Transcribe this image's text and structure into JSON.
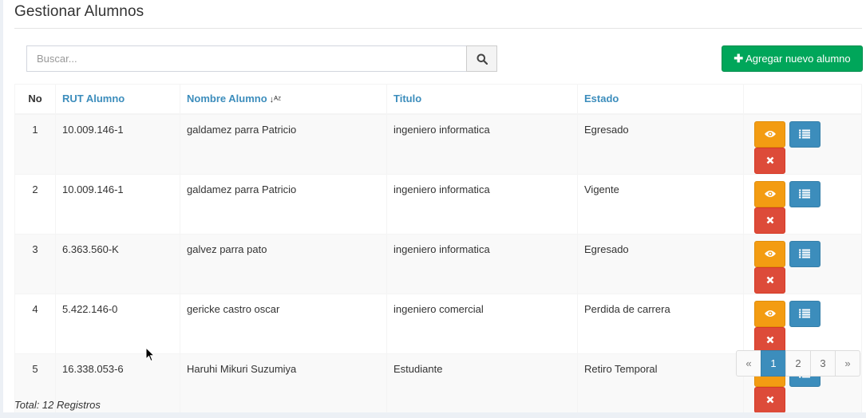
{
  "page": {
    "title": "Gestionar Alumnos",
    "total_label": "Total: 12 Registros"
  },
  "search": {
    "placeholder": "Buscar...",
    "button_icon": "search-icon"
  },
  "add_button": {
    "icon": "plus-icon",
    "label": "Agregar nuevo alumno"
  },
  "table": {
    "headers": {
      "no": "No",
      "rut": "RUT Alumno",
      "nombre": "Nombre Alumno",
      "titulo": "Titulo",
      "estado": "Estado"
    },
    "sort_icon": "sort-alpha-asc-icon",
    "rows": [
      {
        "no": "1",
        "rut": "10.009.146-1",
        "nombre": "galdamez parra Patricio",
        "titulo": "ingeniero informatica",
        "estado": "Egresado"
      },
      {
        "no": "2",
        "rut": "10.009.146-1",
        "nombre": "galdamez parra Patricio",
        "titulo": "ingeniero informatica",
        "estado": "Vigente"
      },
      {
        "no": "3",
        "rut": "6.363.560-K",
        "nombre": "galvez parra pato",
        "titulo": "ingeniero informatica",
        "estado": "Egresado"
      },
      {
        "no": "4",
        "rut": "5.422.146-0",
        "nombre": "gericke castro oscar",
        "titulo": "ingeniero comercial",
        "estado": "Perdida de carrera"
      },
      {
        "no": "5",
        "rut": "16.338.053-6",
        "nombre": "Haruhi Mikuri Suzumiya",
        "titulo": "Estudiante",
        "estado": "Retiro Temporal"
      }
    ],
    "row_actions": [
      "eye-icon",
      "list-icon",
      "close-icon"
    ]
  },
  "pagination": {
    "prev": "«",
    "pages": [
      "1",
      "2",
      "3"
    ],
    "active": "1",
    "next": "»"
  },
  "colors": {
    "accent": "#3c8dbc",
    "success": "#00a65a",
    "warning": "#f39c12",
    "danger": "#dd4b39"
  }
}
